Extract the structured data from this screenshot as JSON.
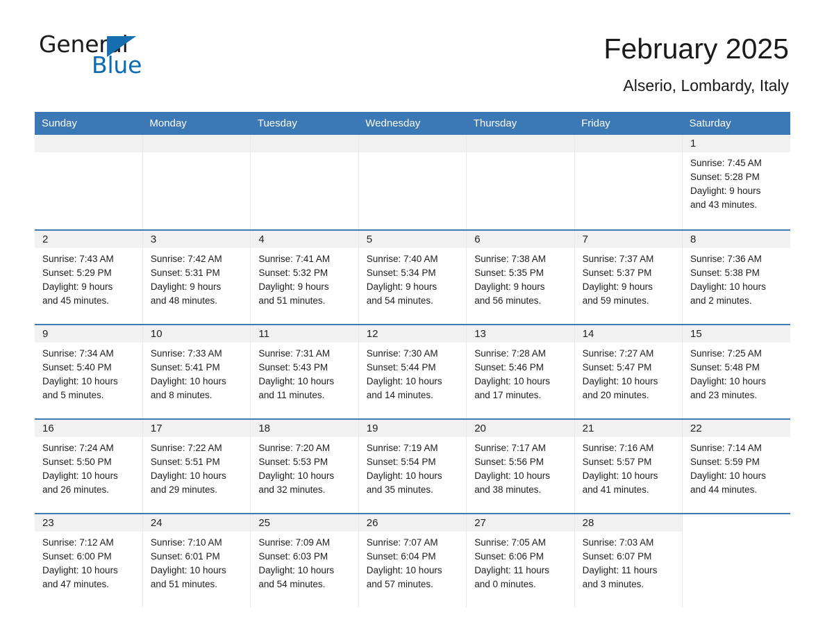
{
  "brand": {
    "general": "General",
    "blue": "Blue",
    "triangle_color": "#176fb0"
  },
  "header": {
    "title": "February 2025",
    "subtitle": "Alserio, Lombardy, Italy"
  },
  "theme": {
    "header_blue": "#3b78b5",
    "day_band_gray": "#f1f1f1",
    "row_rule_blue": "#3b78b5"
  },
  "weekdays": [
    "Sunday",
    "Monday",
    "Tuesday",
    "Wednesday",
    "Thursday",
    "Friday",
    "Saturday"
  ],
  "weeks": [
    [
      {
        "blank": true
      },
      {
        "blank": true
      },
      {
        "blank": true
      },
      {
        "blank": true
      },
      {
        "blank": true
      },
      {
        "blank": true
      },
      {
        "day": "1",
        "sunrise": "Sunrise: 7:45 AM",
        "sunset": "Sunset: 5:28 PM",
        "daylight1": "Daylight: 9 hours",
        "daylight2": "and 43 minutes."
      }
    ],
    [
      {
        "day": "2",
        "sunrise": "Sunrise: 7:43 AM",
        "sunset": "Sunset: 5:29 PM",
        "daylight1": "Daylight: 9 hours",
        "daylight2": "and 45 minutes."
      },
      {
        "day": "3",
        "sunrise": "Sunrise: 7:42 AM",
        "sunset": "Sunset: 5:31 PM",
        "daylight1": "Daylight: 9 hours",
        "daylight2": "and 48 minutes."
      },
      {
        "day": "4",
        "sunrise": "Sunrise: 7:41 AM",
        "sunset": "Sunset: 5:32 PM",
        "daylight1": "Daylight: 9 hours",
        "daylight2": "and 51 minutes."
      },
      {
        "day": "5",
        "sunrise": "Sunrise: 7:40 AM",
        "sunset": "Sunset: 5:34 PM",
        "daylight1": "Daylight: 9 hours",
        "daylight2": "and 54 minutes."
      },
      {
        "day": "6",
        "sunrise": "Sunrise: 7:38 AM",
        "sunset": "Sunset: 5:35 PM",
        "daylight1": "Daylight: 9 hours",
        "daylight2": "and 56 minutes."
      },
      {
        "day": "7",
        "sunrise": "Sunrise: 7:37 AM",
        "sunset": "Sunset: 5:37 PM",
        "daylight1": "Daylight: 9 hours",
        "daylight2": "and 59 minutes."
      },
      {
        "day": "8",
        "sunrise": "Sunrise: 7:36 AM",
        "sunset": "Sunset: 5:38 PM",
        "daylight1": "Daylight: 10 hours",
        "daylight2": "and 2 minutes."
      }
    ],
    [
      {
        "day": "9",
        "sunrise": "Sunrise: 7:34 AM",
        "sunset": "Sunset: 5:40 PM",
        "daylight1": "Daylight: 10 hours",
        "daylight2": "and 5 minutes."
      },
      {
        "day": "10",
        "sunrise": "Sunrise: 7:33 AM",
        "sunset": "Sunset: 5:41 PM",
        "daylight1": "Daylight: 10 hours",
        "daylight2": "and 8 minutes."
      },
      {
        "day": "11",
        "sunrise": "Sunrise: 7:31 AM",
        "sunset": "Sunset: 5:43 PM",
        "daylight1": "Daylight: 10 hours",
        "daylight2": "and 11 minutes."
      },
      {
        "day": "12",
        "sunrise": "Sunrise: 7:30 AM",
        "sunset": "Sunset: 5:44 PM",
        "daylight1": "Daylight: 10 hours",
        "daylight2": "and 14 minutes."
      },
      {
        "day": "13",
        "sunrise": "Sunrise: 7:28 AM",
        "sunset": "Sunset: 5:46 PM",
        "daylight1": "Daylight: 10 hours",
        "daylight2": "and 17 minutes."
      },
      {
        "day": "14",
        "sunrise": "Sunrise: 7:27 AM",
        "sunset": "Sunset: 5:47 PM",
        "daylight1": "Daylight: 10 hours",
        "daylight2": "and 20 minutes."
      },
      {
        "day": "15",
        "sunrise": "Sunrise: 7:25 AM",
        "sunset": "Sunset: 5:48 PM",
        "daylight1": "Daylight: 10 hours",
        "daylight2": "and 23 minutes."
      }
    ],
    [
      {
        "day": "16",
        "sunrise": "Sunrise: 7:24 AM",
        "sunset": "Sunset: 5:50 PM",
        "daylight1": "Daylight: 10 hours",
        "daylight2": "and 26 minutes."
      },
      {
        "day": "17",
        "sunrise": "Sunrise: 7:22 AM",
        "sunset": "Sunset: 5:51 PM",
        "daylight1": "Daylight: 10 hours",
        "daylight2": "and 29 minutes."
      },
      {
        "day": "18",
        "sunrise": "Sunrise: 7:20 AM",
        "sunset": "Sunset: 5:53 PM",
        "daylight1": "Daylight: 10 hours",
        "daylight2": "and 32 minutes."
      },
      {
        "day": "19",
        "sunrise": "Sunrise: 7:19 AM",
        "sunset": "Sunset: 5:54 PM",
        "daylight1": "Daylight: 10 hours",
        "daylight2": "and 35 minutes."
      },
      {
        "day": "20",
        "sunrise": "Sunrise: 7:17 AM",
        "sunset": "Sunset: 5:56 PM",
        "daylight1": "Daylight: 10 hours",
        "daylight2": "and 38 minutes."
      },
      {
        "day": "21",
        "sunrise": "Sunrise: 7:16 AM",
        "sunset": "Sunset: 5:57 PM",
        "daylight1": "Daylight: 10 hours",
        "daylight2": "and 41 minutes."
      },
      {
        "day": "22",
        "sunrise": "Sunrise: 7:14 AM",
        "sunset": "Sunset: 5:59 PM",
        "daylight1": "Daylight: 10 hours",
        "daylight2": "and 44 minutes."
      }
    ],
    [
      {
        "day": "23",
        "sunrise": "Sunrise: 7:12 AM",
        "sunset": "Sunset: 6:00 PM",
        "daylight1": "Daylight: 10 hours",
        "daylight2": "and 47 minutes."
      },
      {
        "day": "24",
        "sunrise": "Sunrise: 7:10 AM",
        "sunset": "Sunset: 6:01 PM",
        "daylight1": "Daylight: 10 hours",
        "daylight2": "and 51 minutes."
      },
      {
        "day": "25",
        "sunrise": "Sunrise: 7:09 AM",
        "sunset": "Sunset: 6:03 PM",
        "daylight1": "Daylight: 10 hours",
        "daylight2": "and 54 minutes."
      },
      {
        "day": "26",
        "sunrise": "Sunrise: 7:07 AM",
        "sunset": "Sunset: 6:04 PM",
        "daylight1": "Daylight: 10 hours",
        "daylight2": "and 57 minutes."
      },
      {
        "day": "27",
        "sunrise": "Sunrise: 7:05 AM",
        "sunset": "Sunset: 6:06 PM",
        "daylight1": "Daylight: 11 hours",
        "daylight2": "and 0 minutes."
      },
      {
        "day": "28",
        "sunrise": "Sunrise: 7:03 AM",
        "sunset": "Sunset: 6:07 PM",
        "daylight1": "Daylight: 11 hours",
        "daylight2": "and 3 minutes."
      },
      {
        "empty": true
      }
    ]
  ]
}
